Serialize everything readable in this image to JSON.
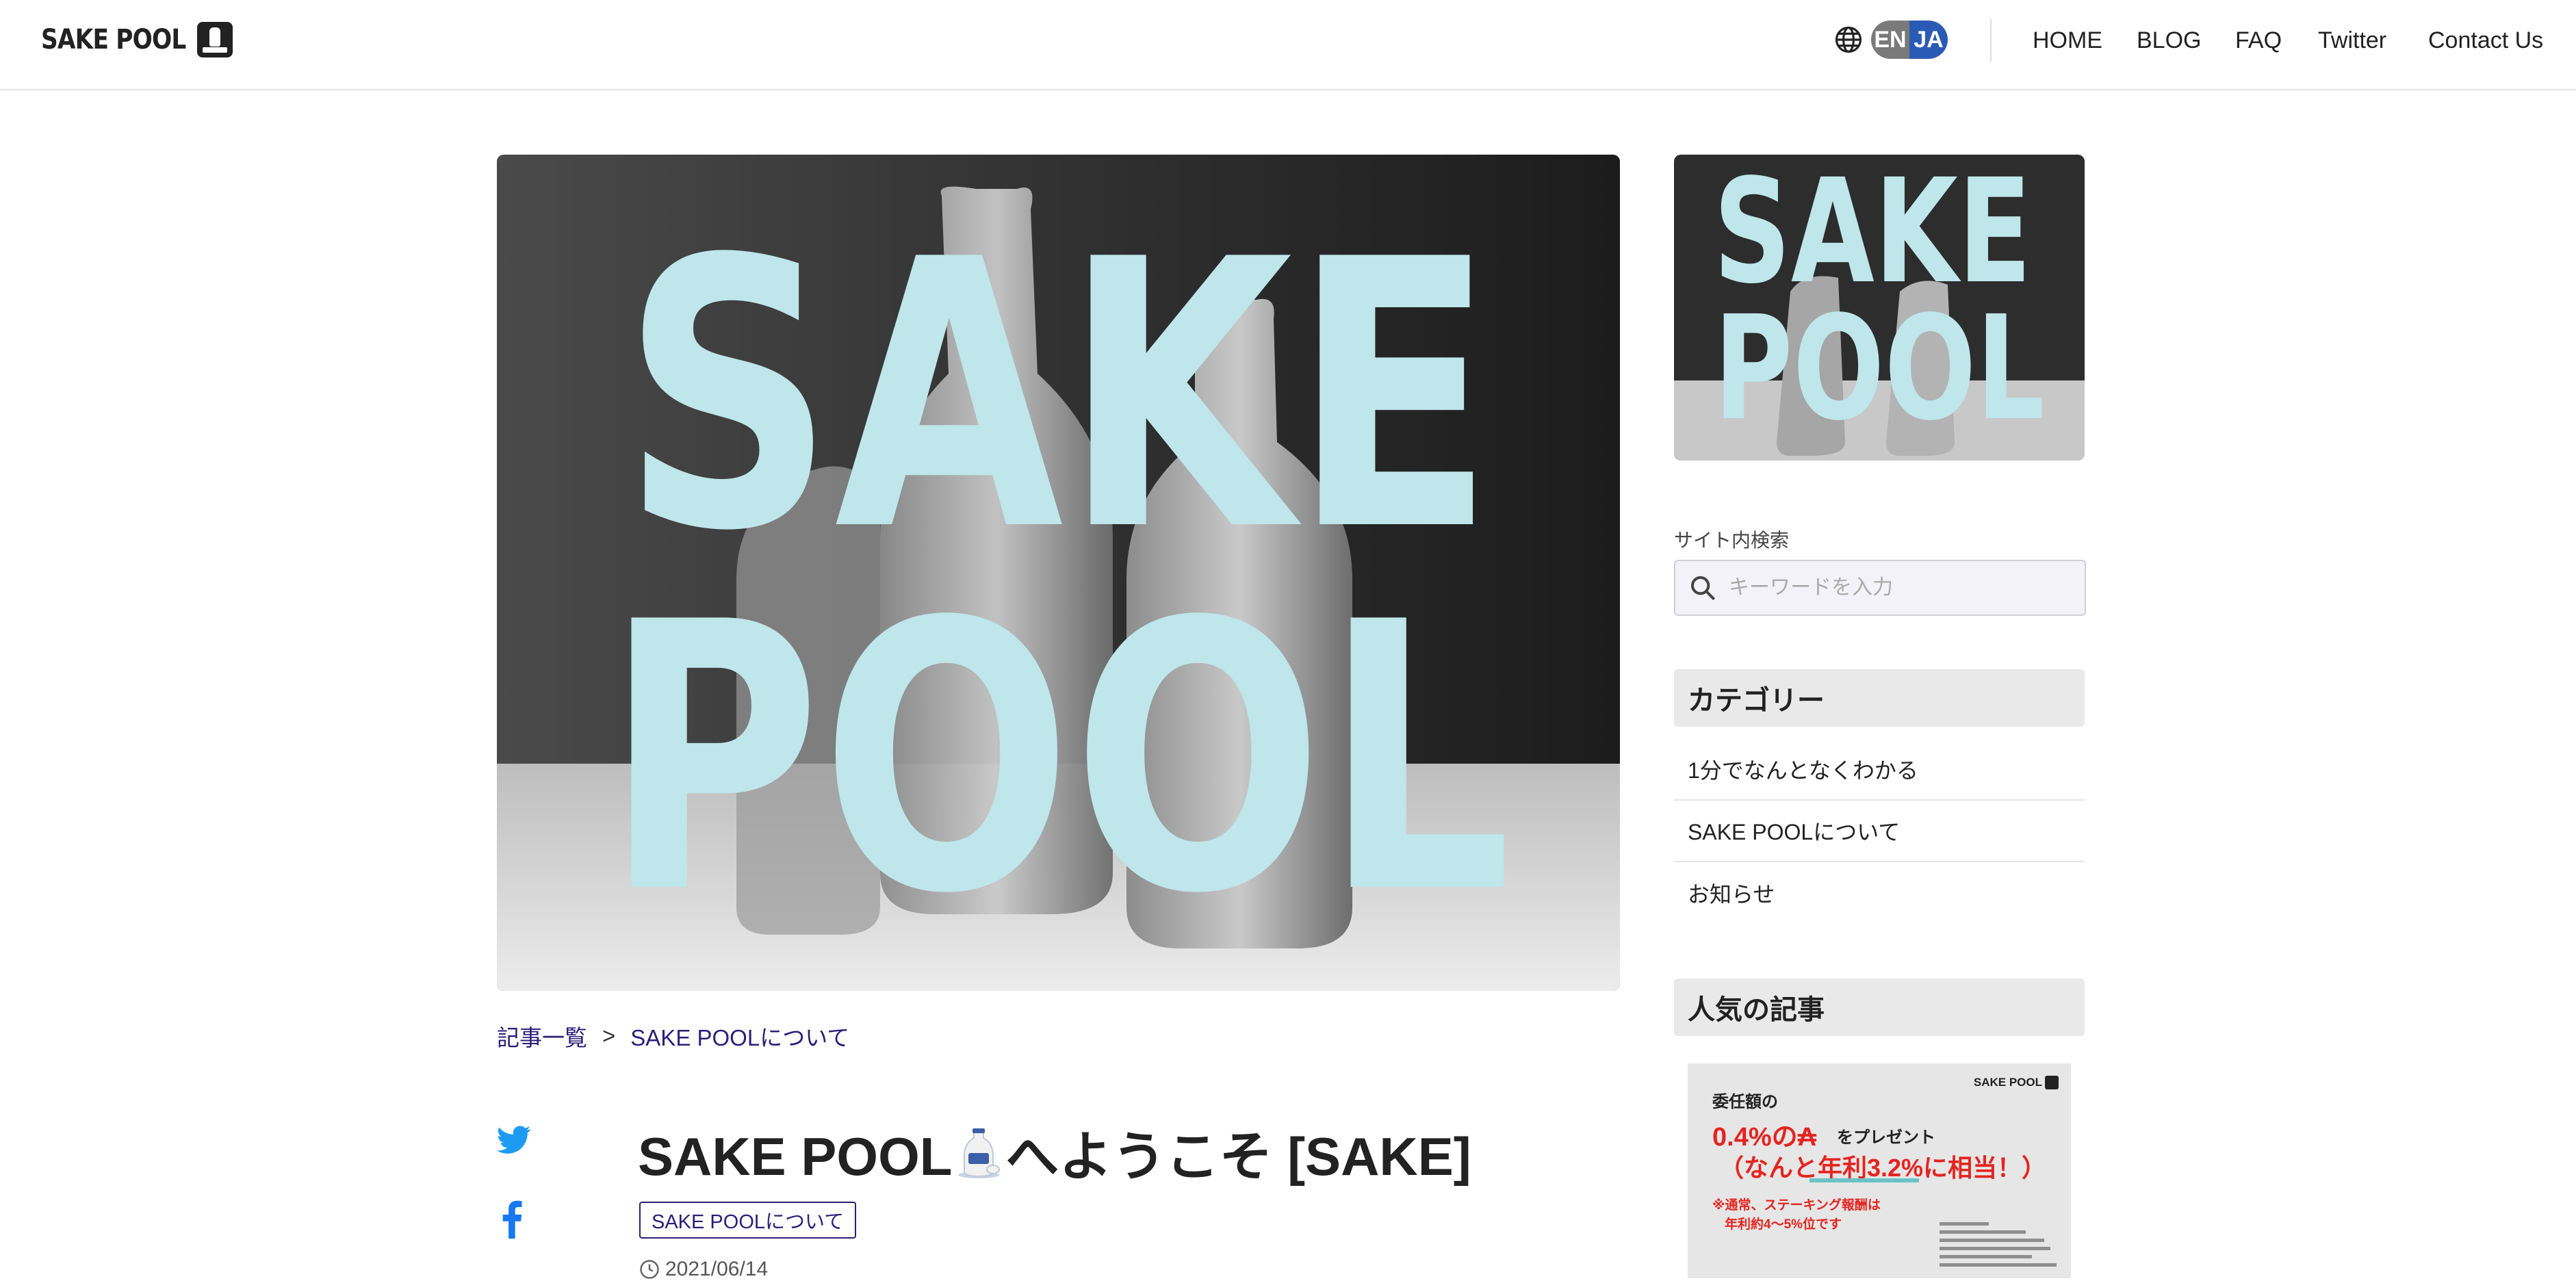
{
  "header": {
    "logo_text": "SAKE POOL",
    "lang": {
      "en": "EN",
      "ja": "JA"
    },
    "nav": [
      "HOME",
      "BLOG",
      "FAQ",
      "Twitter",
      "Contact Us"
    ]
  },
  "hero": {
    "line1": "SAKE",
    "line2": "POOL"
  },
  "side_thumb": {
    "line1": "SAKE",
    "line2": "POOL"
  },
  "breadcrumb": {
    "items": [
      "記事一覧",
      "SAKE POOLについて"
    ],
    "separator": ">"
  },
  "post": {
    "title_before": "SAKE POOL",
    "title_after": "へようこそ [SAKE]",
    "tag": "SAKE POOLについて",
    "date": "2021/06/14"
  },
  "sidebar": {
    "search_label": "サイト内検索",
    "search_placeholder": "キーワードを入力",
    "category_heading": "カテゴリー",
    "categories": [
      "1分でなんとなくわかる",
      "SAKE POOLについて",
      "お知らせ"
    ],
    "popular_heading": "人気の記事",
    "popular_card": {
      "logo": "SAKE POOL",
      "line1": "委任額の",
      "line2": "0.4%の₳",
      "line2b": "をプレゼント",
      "line3": "（なんと年利3.2%に相当！）",
      "line4": "※通常、ステーキング報酬は",
      "line5": "年利約4〜5%位です"
    }
  },
  "colors": {
    "accent": "#2b1f7a",
    "lang_active": "#2a5bb4",
    "hero_text": "#bfe6ea",
    "promo_red": "#e52420"
  }
}
